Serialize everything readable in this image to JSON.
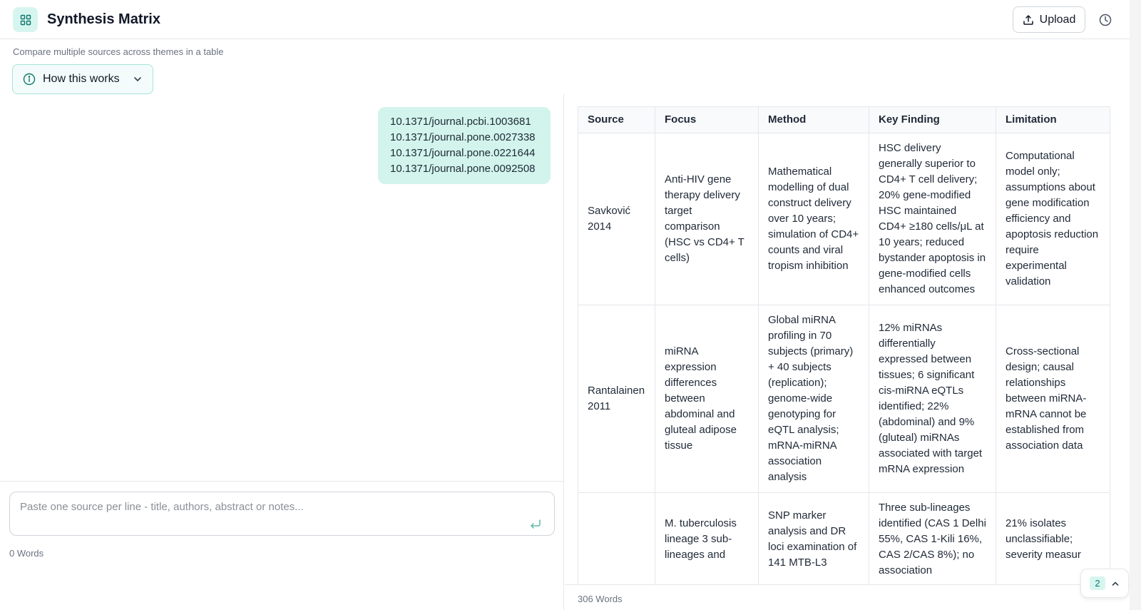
{
  "header": {
    "title": "Synthesis Matrix",
    "upload_label": "Upload"
  },
  "subtitle": "Compare multiple sources across themes in a table",
  "how_it_works_label": "How this works",
  "sources_bubble": [
    "10.1371/journal.pcbi.1003681",
    "10.1371/journal.pone.0027338",
    "10.1371/journal.pone.0221644",
    "10.1371/journal.pone.0092508"
  ],
  "input": {
    "placeholder": "Paste one source per line - title, authors, abstract or notes...",
    "word_count": "0 Words"
  },
  "table": {
    "headers": [
      "Source",
      "Focus",
      "Method",
      "Key Finding",
      "Limitation"
    ],
    "rows": [
      [
        "Savković 2014",
        "Anti-HIV gene therapy delivery target comparison (HSC vs CD4+ T cells)",
        "Mathematical modelling of dual construct delivery over 10 years; simulation of CD4+ counts and viral tropism inhibition",
        "HSC delivery generally superior to CD4+ T cell delivery; 20% gene-modified HSC maintained CD4+ ≥180 cells/μL at 10 years; reduced bystander apoptosis in gene-modified cells enhanced outcomes",
        "Computational model only; assumptions about gene modification efficiency and apoptosis reduction require experimental validation"
      ],
      [
        "Rantalainen 2011",
        "miRNA expression differences between abdominal and gluteal adipose tissue",
        "Global miRNA profiling in 70 subjects (primary) + 40 subjects (replication); genome-wide genotyping for eQTL analysis; mRNA-miRNA association analysis",
        "12% miRNAs differentially expressed between tissues; 6 significant cis-miRNA eQTLs identified; 22% (abdominal) and 9% (gluteal) miRNAs associated with target mRNA expression",
        "Cross-sectional design; causal relationships between miRNA-mRNA cannot be established from association data"
      ],
      [
        "",
        "M. tuberculosis lineage 3 sub-lineages and",
        "SNP marker analysis and DR loci examination of 141 MTB-L3",
        "Three sub-lineages identified (CAS 1 Delhi 55%, CAS 1-Kili 16%, CAS 2/CAS 8%); no association",
        "21% isolates unclassifiable; severity measur"
      ]
    ],
    "word_count": "306 Words"
  },
  "pagination": {
    "current": "2"
  }
}
